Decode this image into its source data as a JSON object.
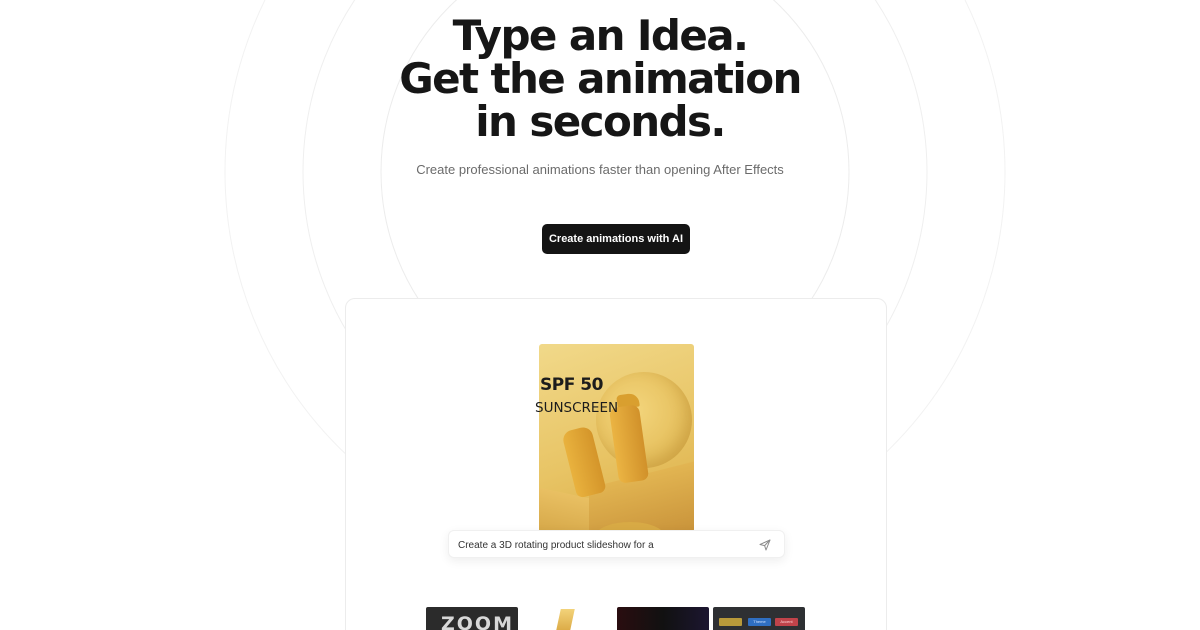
{
  "hero": {
    "title_line1": "Type an Idea.",
    "title_line2": "Get the animation",
    "title_line3": "in seconds.",
    "subtitle": "Create professional animations faster than opening After Effects"
  },
  "cta": {
    "label": "Create animations with AI"
  },
  "demo": {
    "product_line1": "SPF 50",
    "product_line2": "SUNSCREEN",
    "prompt_value": "Create a 3D rotating product slideshow for a",
    "send_icon": "send-icon"
  },
  "thumbnails": {
    "zoom_label": "ZOOM",
    "chips": [
      "",
      "Theme",
      "Accent"
    ]
  }
}
